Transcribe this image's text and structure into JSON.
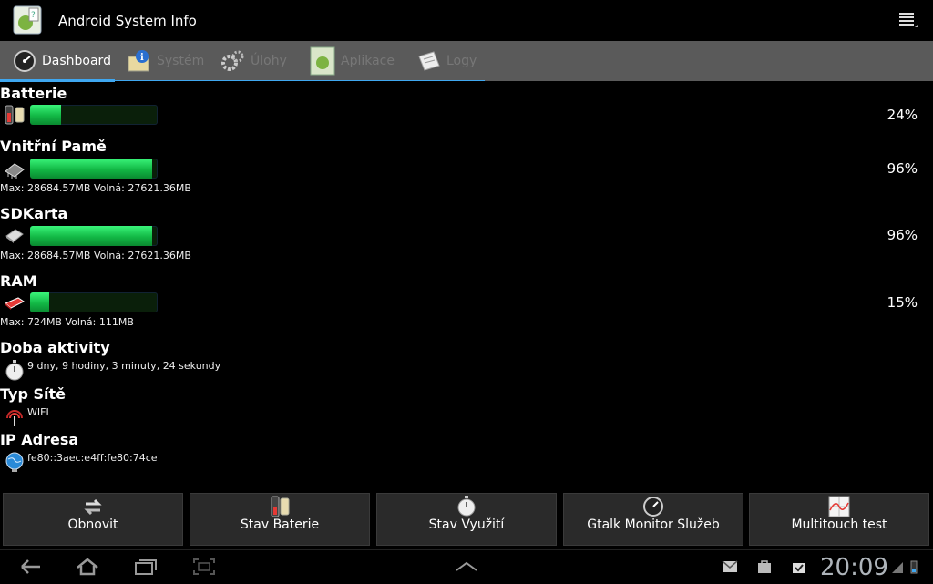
{
  "app": {
    "title": "Android System Info"
  },
  "tabs": [
    {
      "label": "Dashboard",
      "icon": "gauge-icon",
      "active": true
    },
    {
      "label": "Systém",
      "icon": "info-map-icon",
      "active": false
    },
    {
      "label": "Úlohy",
      "icon": "gears-icon",
      "active": false
    },
    {
      "label": "Aplikace",
      "icon": "android-icon",
      "active": false
    },
    {
      "label": "Logy",
      "icon": "log-icon",
      "active": false
    }
  ],
  "sections": {
    "battery": {
      "title": "Batterie",
      "percent": "24%",
      "fill": 0.24,
      "icon": "battery-icon"
    },
    "internal": {
      "title": "Vnitřní Pamě",
      "percent": "96%",
      "fill": 0.96,
      "detail": "Max: 28684.57MB Volná: 27621.36MB",
      "icon": "chip-icon"
    },
    "sdcard": {
      "title": "SDKarta",
      "percent": "96%",
      "fill": 0.96,
      "detail": "Max: 28684.57MB Volná: 27621.36MB",
      "icon": "sdcard-icon"
    },
    "ram": {
      "title": "RAM",
      "percent": "15%",
      "fill": 0.15,
      "detail": "Max: 724MB Volná: 111MB",
      "icon": "ram-icon"
    },
    "uptime": {
      "title": "Doba aktivity",
      "value": "9 dny, 9 hodiny, 3 minuty, 24 sekundy",
      "icon": "stopwatch-icon"
    },
    "network": {
      "title": "Typ Sítě",
      "value": "WIFI",
      "icon": "wifi-antenna-icon"
    },
    "ip": {
      "title": "IP Adresa",
      "value": "fe80::3aec:e4ff:fe80:74ce",
      "icon": "globe-icon"
    }
  },
  "buttons": [
    {
      "label": "Obnovit",
      "icon": "refresh-icon"
    },
    {
      "label": "Stav Baterie",
      "icon": "battery-icon"
    },
    {
      "label": "Stav Využití",
      "icon": "stopwatch-icon"
    },
    {
      "label": "Gtalk Monitor Služeb",
      "icon": "gauge-icon"
    },
    {
      "label": "Multitouch test",
      "icon": "chart-icon"
    }
  ],
  "statusbar": {
    "clock": "20:09"
  },
  "colors": {
    "bar_fill": "#12b845",
    "accent": "#3fa7f0",
    "tab_bg": "#5a5a5a"
  }
}
